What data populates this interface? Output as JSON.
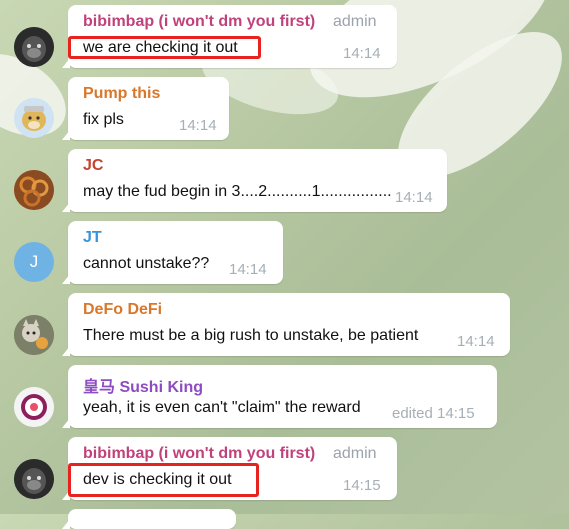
{
  "messages": [
    {
      "name": "bibimbap (i won't dm you first)",
      "name_color": "#c0427c",
      "badge": "admin",
      "text": "we are checking it out",
      "time": "14:14",
      "avatar": "gorilla-avatar"
    },
    {
      "name": "Pump this",
      "name_color": "#d9782a",
      "text": "fix pls",
      "time": "14:14",
      "avatar": "doge-avatar"
    },
    {
      "name": "JC",
      "name_color": "#c4452f",
      "text": "may the fud begin in 3....2..........1................",
      "time": "14:14",
      "avatar": "food-avatar"
    },
    {
      "name": "JT",
      "name_color": "#3a93d6",
      "text": "cannot unstake??",
      "time": "14:14",
      "avatar_letter": "J",
      "avatar_color": "#6fb3e4"
    },
    {
      "name": "DeFo DeFi",
      "name_color": "#d9782a",
      "text": "There must be a big rush to unstake, be patient",
      "time": "14:14",
      "avatar": "dog-avatar"
    },
    {
      "name": "皇马 Sushi King",
      "name_color": "#8e4cc4",
      "text": "yeah, it is even can't \"claim\" the reward",
      "time": "edited 14:15",
      "avatar": "sushi-avatar"
    },
    {
      "name": "bibimbap (i won't dm you first)",
      "name_color": "#c0427c",
      "badge": "admin",
      "text": "dev is checking it out",
      "time": "14:15",
      "avatar": "gorilla-avatar"
    }
  ]
}
